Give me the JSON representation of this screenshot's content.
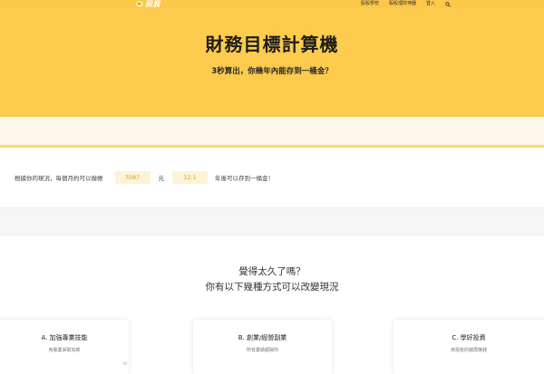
{
  "nav": {
    "logo_text": "股股",
    "links": [
      "股股學校",
      "股股理財神器",
      "登入"
    ],
    "search_icon": "search-icon"
  },
  "hero": {
    "title": "財務目標計算機",
    "subtitle": "3秒算出，你幾年內能存到一桶金？"
  },
  "calculator": {
    "prefix": "根據你的現況，每個月約可以撥帳",
    "monthly_amount": "7087",
    "unit": "元",
    "years": "12.1",
    "suffix": "年後可以存到一桶金！"
  },
  "section": {
    "question_line1": "覺得太久了嗎？",
    "question_line2": "你有以下幾種方式可以改變現況"
  },
  "cards": [
    {
      "title": "A. 加強專業技能",
      "desc": "用專業爭取加薪"
    },
    {
      "title": "B. 創業/經營副業",
      "desc": "所有業績都歸你"
    },
    {
      "title": "C. 學好投資",
      "desc": "用現有的錢再賺錢"
    }
  ],
  "colors": {
    "brand_yellow": "#fdcb4d",
    "input_bg": "#fdf3d8",
    "input_text": "#e0a21f"
  }
}
